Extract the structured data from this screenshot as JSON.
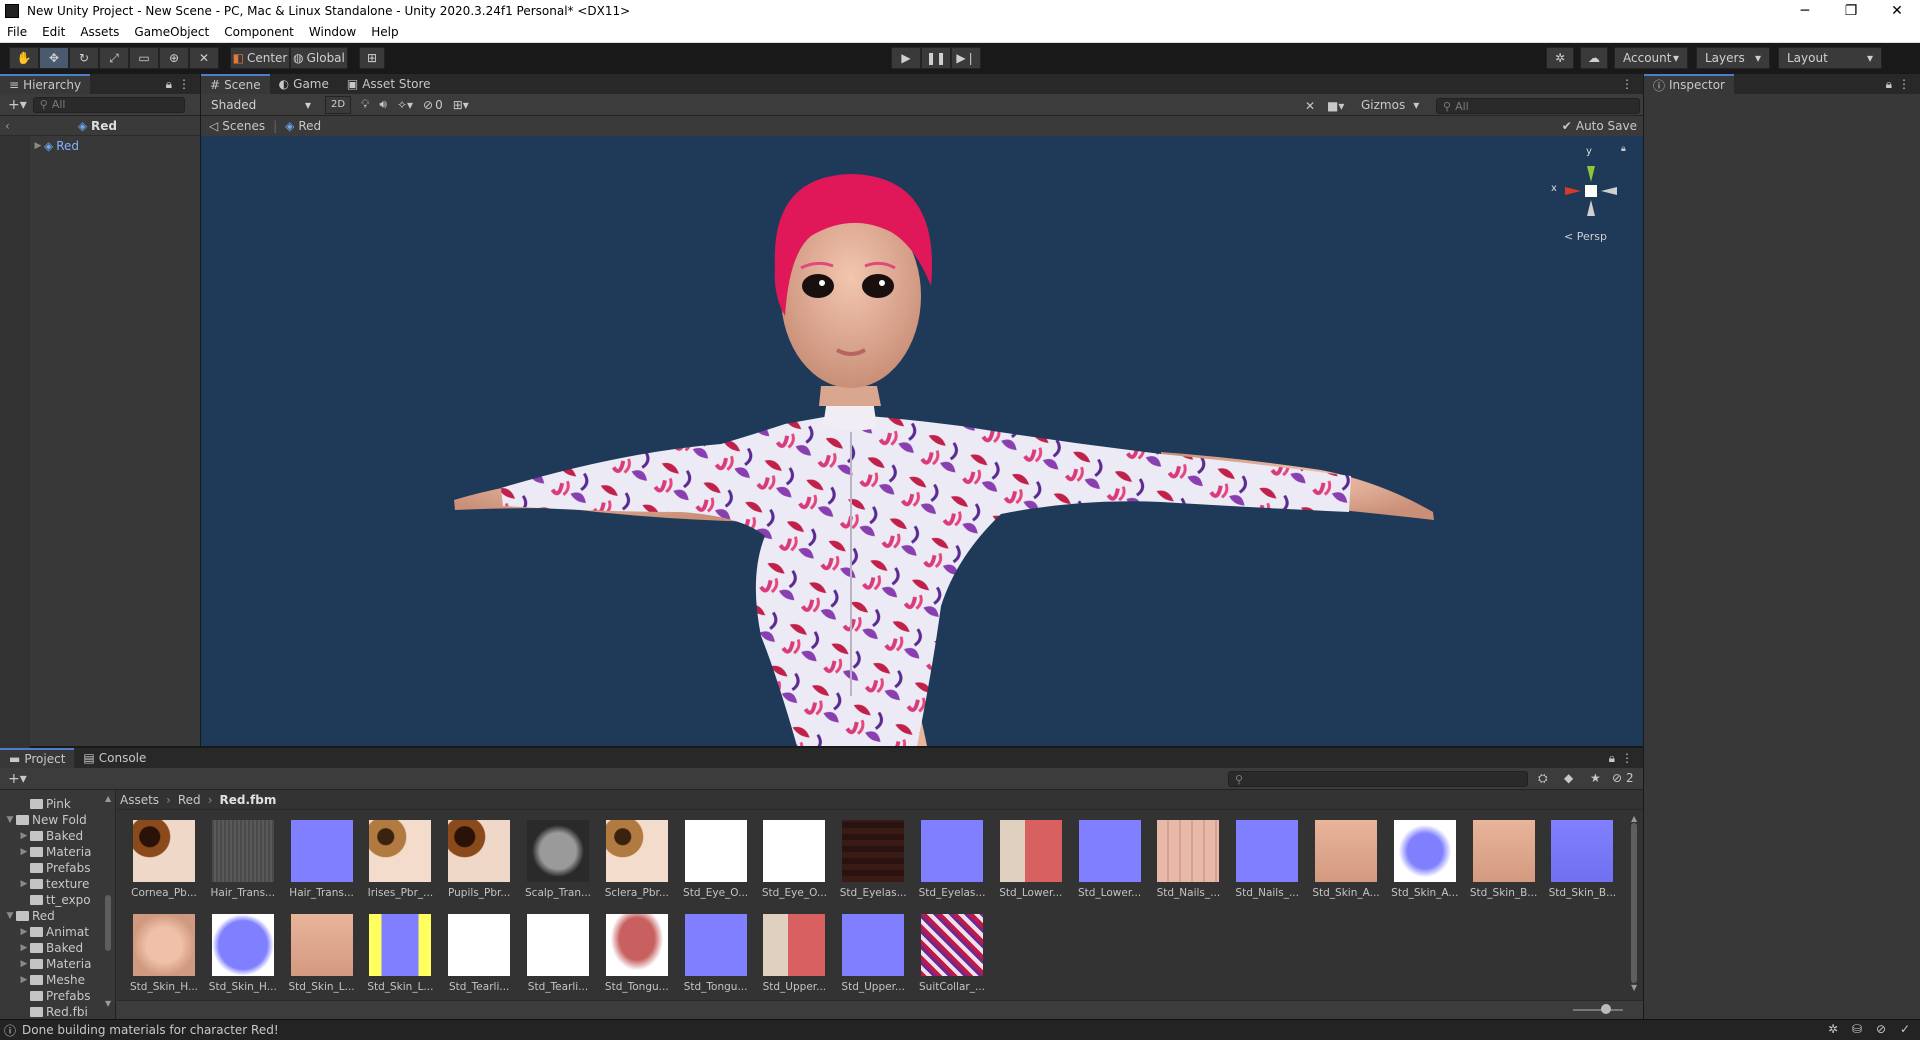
{
  "window": {
    "title": "New Unity Project - New Scene - PC, Mac & Linux Standalone - Unity 2020.3.24f1 Personal* <DX11>",
    "controls": [
      "─",
      "❐",
      "✕"
    ]
  },
  "menu": [
    "File",
    "Edit",
    "Assets",
    "GameObject",
    "Component",
    "Window",
    "Help"
  ],
  "toolbar": {
    "center": "Center",
    "global": "Global",
    "account": "Account",
    "layers": "Layers",
    "layout": "Layout"
  },
  "hierarchy": {
    "tab": "Hierarchy",
    "search_placeholder": "All",
    "root": "Red",
    "child": "Red"
  },
  "scene": {
    "tabs": [
      "Scene",
      "Game",
      "Asset Store"
    ],
    "shading": "Shaded",
    "mode_2d": "2D",
    "hidden_count": "0",
    "gizmos": "Gizmos",
    "search_placeholder": "All",
    "crumb_scenes": "Scenes",
    "crumb_red": "Red",
    "auto_save": "Auto Save",
    "projection": "Persp",
    "axis_x": "x",
    "axis_y": "y"
  },
  "inspector": {
    "tab": "Inspector"
  },
  "project": {
    "tabs": [
      "Project",
      "Console"
    ],
    "breadcrumb": [
      "Assets",
      "Red",
      "Red.fbm"
    ],
    "hidden_count": "2",
    "tree": [
      {
        "label": "Pink",
        "depth": 1,
        "arrow": ""
      },
      {
        "label": "New Fold",
        "depth": 0,
        "arrow": "▼"
      },
      {
        "label": "Baked",
        "depth": 1,
        "arrow": "▶"
      },
      {
        "label": "Materia",
        "depth": 1,
        "arrow": "▶"
      },
      {
        "label": "Prefabs",
        "depth": 1,
        "arrow": ""
      },
      {
        "label": "texture",
        "depth": 1,
        "arrow": "▶"
      },
      {
        "label": "tt_expo",
        "depth": 1,
        "arrow": ""
      },
      {
        "label": "Red",
        "depth": 0,
        "arrow": "▼"
      },
      {
        "label": "Animat",
        "depth": 1,
        "arrow": "▶"
      },
      {
        "label": "Baked",
        "depth": 1,
        "arrow": "▶"
      },
      {
        "label": "Materia",
        "depth": 1,
        "arrow": "▶"
      },
      {
        "label": "Meshe",
        "depth": 1,
        "arrow": "▶"
      },
      {
        "label": "Prefabs",
        "depth": 1,
        "arrow": ""
      },
      {
        "label": "Red.fbi",
        "depth": 1,
        "arrow": ""
      }
    ],
    "assets": [
      {
        "label": "Cornea_Pb...",
        "kind": "eye"
      },
      {
        "label": "Hair_Trans...",
        "kind": "hair"
      },
      {
        "label": "Hair_Trans...",
        "kind": "normal"
      },
      {
        "label": "Irises_Pbr_...",
        "kind": "iris"
      },
      {
        "label": "Pupils_Pbr...",
        "kind": "eye"
      },
      {
        "label": "Scalp_Tran...",
        "kind": "scalp"
      },
      {
        "label": "Sclera_Pbr...",
        "kind": "iris"
      },
      {
        "label": "Std_Eye_O...",
        "kind": "white"
      },
      {
        "label": "Std_Eye_O...",
        "kind": "white"
      },
      {
        "label": "Std_Eyelas...",
        "kind": "lash"
      },
      {
        "label": "Std_Eyelas...",
        "kind": "normal"
      },
      {
        "label": "Std_Lower...",
        "kind": "teeth"
      },
      {
        "label": "Std_Lower...",
        "kind": "normal"
      },
      {
        "label": "Std_Nails_...",
        "kind": "nails"
      },
      {
        "label": "Std_Nails_...",
        "kind": "normal"
      },
      {
        "label": "Std_Skin_A...",
        "kind": "skin"
      },
      {
        "label": "Std_Skin_A...",
        "kind": "normalarms"
      },
      {
        "label": "Std_Skin_B...",
        "kind": "skin"
      },
      {
        "label": "Std_Skin_B...",
        "kind": "normalbody"
      },
      {
        "label": "Std_Skin_H...",
        "kind": "face"
      },
      {
        "label": "Std_Skin_H...",
        "kind": "normalhead"
      },
      {
        "label": "Std_Skin_L...",
        "kind": "skin"
      },
      {
        "label": "Std_Skin_L...",
        "kind": "normallegs"
      },
      {
        "label": "Std_Tearli...",
        "kind": "white"
      },
      {
        "label": "Std_Tearli...",
        "kind": "white"
      },
      {
        "label": "Std_Tongu...",
        "kind": "tongue"
      },
      {
        "label": "Std_Tongu...",
        "kind": "normal"
      },
      {
        "label": "Std_Upper...",
        "kind": "teeth"
      },
      {
        "label": "Std_Upper...",
        "kind": "normal"
      },
      {
        "label": "SuitCollar_...",
        "kind": "pattern"
      }
    ]
  },
  "status": {
    "message": "Done building materials for character Red!"
  },
  "colors": {
    "accent": "#4c7fc7",
    "scene_bg": "#1f3a58",
    "hair": "#e0185a",
    "normal_map": "#7f7fff"
  }
}
